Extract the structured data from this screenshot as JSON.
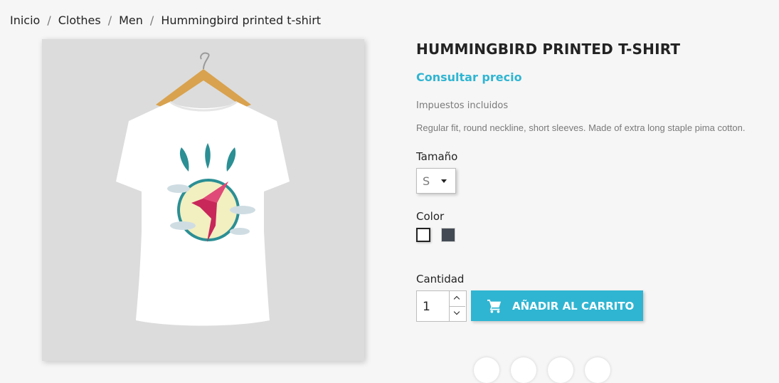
{
  "breadcrumb": {
    "items": [
      "Inicio",
      "Clothes",
      "Men",
      "Hummingbird printed t-shirt"
    ],
    "separator": "/"
  },
  "product": {
    "title": "HUMMINGBIRD PRINTED T-SHIRT",
    "price_label": "Consultar precio",
    "tax_note": "Impuestos incluidos",
    "description": "Regular fit, round neckline, short sleeves. Made of extra long staple pima cotton."
  },
  "variants": {
    "size_label": "Tamaño",
    "size_selected": "S",
    "color_label": "Color",
    "colors": [
      {
        "name": "white",
        "hex": "#ffffff"
      },
      {
        "name": "dark-gray",
        "hex": "#434a54"
      }
    ]
  },
  "cart": {
    "quantity_label": "Cantidad",
    "quantity": "1",
    "add_button_label": "AÑADIR AL CARRITO",
    "icon": "shopping-cart-icon"
  },
  "colors": {
    "accent": "#2fb5d2",
    "text": "#232323",
    "muted": "#7a7a7a",
    "background": "#f6f6f6"
  }
}
